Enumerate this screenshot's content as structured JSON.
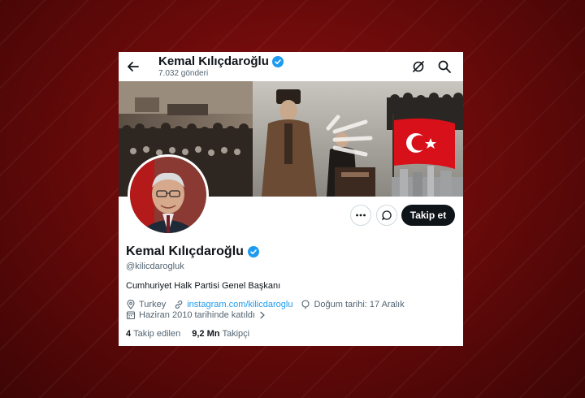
{
  "header": {
    "name": "Kemal Kılıçdaroğlu",
    "posts_count": "7.032 gönderi"
  },
  "actions": {
    "follow_label": "Takip et"
  },
  "profile": {
    "name": "Kemal Kılıçdaroğlu",
    "handle": "@kilicdarogluk",
    "bio": "Cumhuriyet Halk Partisi Genel Başkanı",
    "location": "Turkey",
    "website": "instagram.com/kilicdaroglu",
    "birthday": "Doğum tarihi: 17 Aralık",
    "joined": "Haziran 2010 tarihinde katıldı",
    "following_count": "4",
    "following_label": "Takip edilen",
    "followers_count": "9,2 Mn",
    "followers_label": "Takipçi"
  },
  "colors": {
    "accent": "#1d9bf0",
    "text": "#0f1419",
    "muted": "#536471",
    "follow_button": "#0f1419",
    "background": "#7a0c0c"
  },
  "icons": [
    "back-arrow-icon",
    "verified-badge-icon",
    "grok-icon",
    "search-icon",
    "more-icon",
    "message-icon",
    "location-icon",
    "link-icon",
    "birthday-icon",
    "calendar-icon",
    "chevron-right-icon"
  ]
}
